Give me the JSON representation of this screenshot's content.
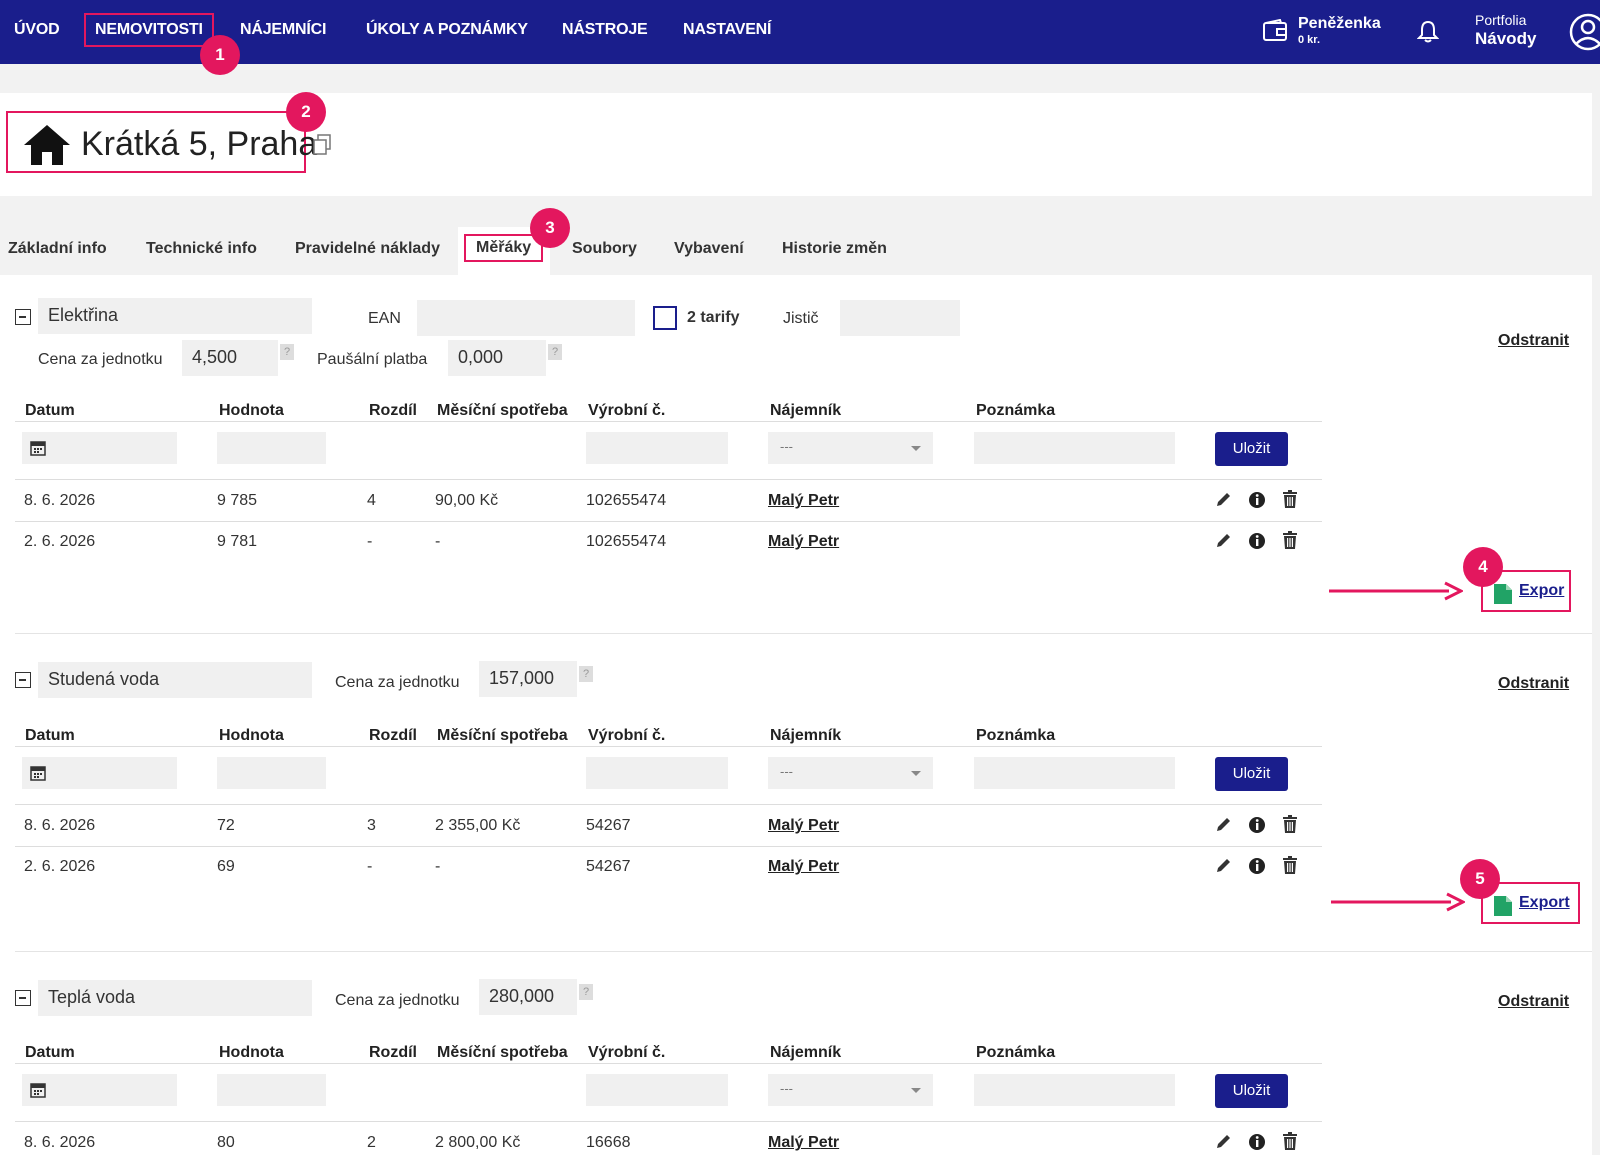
{
  "nav": {
    "items": [
      "ÚVOD",
      "NEMOVITOSTI",
      "NÁJEMNÍCI",
      "ÚKOLY A POZNÁMKY",
      "NÁSTROJE",
      "NASTAVENÍ"
    ],
    "wallet_title": "Peněženka",
    "wallet_amount": "0 kr.",
    "portfolio_label": "Portfolia",
    "guides_label": "Návody"
  },
  "property": {
    "title": "Krátká 5, Praha"
  },
  "tabs": [
    "Základní info",
    "Technické info",
    "Pravidelné náklady",
    "Měřáky",
    "Soubory",
    "Vybavení",
    "Historie změn"
  ],
  "active_tab": "Měřáky",
  "badges": [
    "1",
    "2",
    "3",
    "4",
    "5"
  ],
  "columns": [
    "Datum",
    "Hodnota",
    "Rozdíl",
    "Měsíční spotřeba",
    "Výrobní č.",
    "Nájemník",
    "Poznámka"
  ],
  "labels": {
    "ean": "EAN",
    "two_tariffs": "2 tarify",
    "breaker": "Jistič",
    "unit_price": "Cena za jednotku",
    "flat_fee": "Paušální platba",
    "remove": "Odstranit",
    "save": "Uložit",
    "export": "Export",
    "export_clipped": "Expor",
    "tenant_placeholder": "---",
    "help": "?"
  },
  "meters": [
    {
      "name": "Elektřina",
      "unit_price": "4,500",
      "flat_fee": "0,000",
      "rows": [
        {
          "date": "8. 6. 2026",
          "value": "9 785",
          "diff": "4",
          "monthly": "90,00 Kč",
          "serial": "102655474",
          "tenant": "Malý Petr"
        },
        {
          "date": "2. 6. 2026",
          "value": "9 781",
          "diff": "-",
          "monthly": "-",
          "serial": "102655474",
          "tenant": "Malý Petr"
        }
      ]
    },
    {
      "name": "Studená voda",
      "unit_price": "157,000",
      "rows": [
        {
          "date": "8. 6. 2026",
          "value": "72",
          "diff": "3",
          "monthly": "2 355,00 Kč",
          "serial": "54267",
          "tenant": "Malý Petr"
        },
        {
          "date": "2. 6. 2026",
          "value": "69",
          "diff": "-",
          "monthly": "-",
          "serial": "54267",
          "tenant": "Malý Petr"
        }
      ]
    },
    {
      "name": "Teplá voda",
      "unit_price": "280,000",
      "rows": [
        {
          "date": "8. 6. 2026",
          "value": "80",
          "diff": "2",
          "monthly": "2 800,00 Kč",
          "serial": "16668",
          "tenant": "Malý Petr"
        }
      ]
    }
  ],
  "colors": {
    "nav_bg": "#1a1e8c",
    "highlight": "#e3175e",
    "button": "#1a1e8c",
    "excel_green": "#21a366"
  }
}
